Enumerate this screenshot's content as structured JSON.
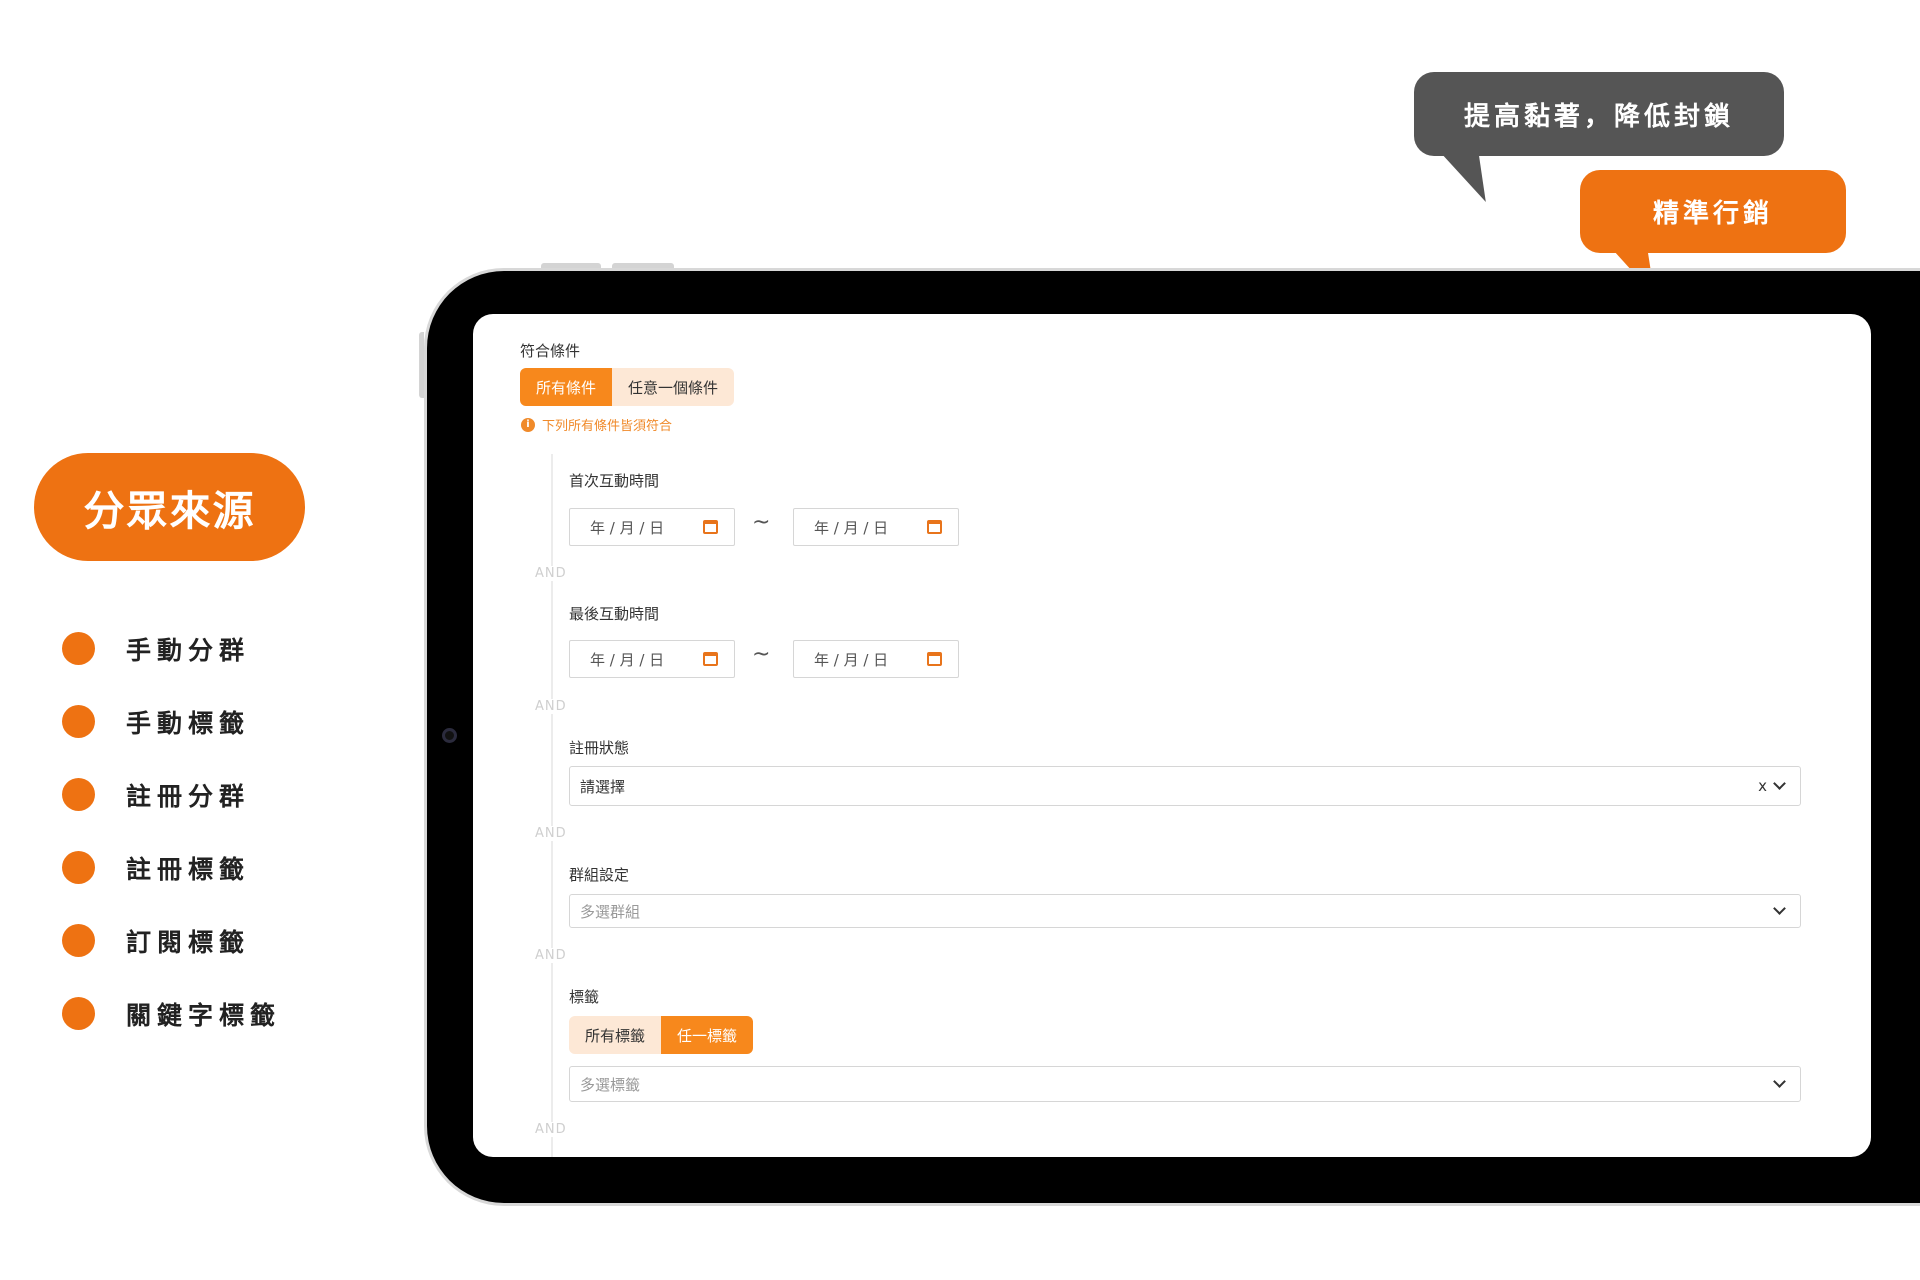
{
  "source_panel": {
    "title": "分眾來源",
    "items": [
      "手動分群",
      "手動標籤",
      "註冊分群",
      "註冊標籤",
      "訂閱標籤",
      "關鍵字標籤"
    ],
    "accent_color": "#ee7212"
  },
  "bubbles": {
    "gray": "提高黏著，降低封鎖",
    "orange": "精準行銷"
  },
  "form": {
    "match_label": "符合條件",
    "match_options": [
      "所有條件",
      "任意一個條件"
    ],
    "match_selected": "所有條件",
    "hint": "下列所有條件皆須符合",
    "info_icon": "info-icon",
    "and_text": "AND",
    "first_interaction": {
      "label": "首次互動時間",
      "start": "年 / 月 / 日",
      "separator": "~",
      "end": "年 / 月 / 日"
    },
    "last_interaction": {
      "label": "最後互動時間",
      "start": "年 / 月 / 日",
      "separator": "~",
      "end": "年 / 月 / 日"
    },
    "register_status": {
      "label": "註冊狀態",
      "value": "請選擇",
      "clear": "x"
    },
    "group": {
      "label": "群組設定",
      "placeholder": "多選群組"
    },
    "tags": {
      "label": "標籤",
      "options": [
        "所有標籤",
        "任一標籤"
      ],
      "selected": "任一標籤",
      "placeholder": "多選標籤"
    }
  }
}
